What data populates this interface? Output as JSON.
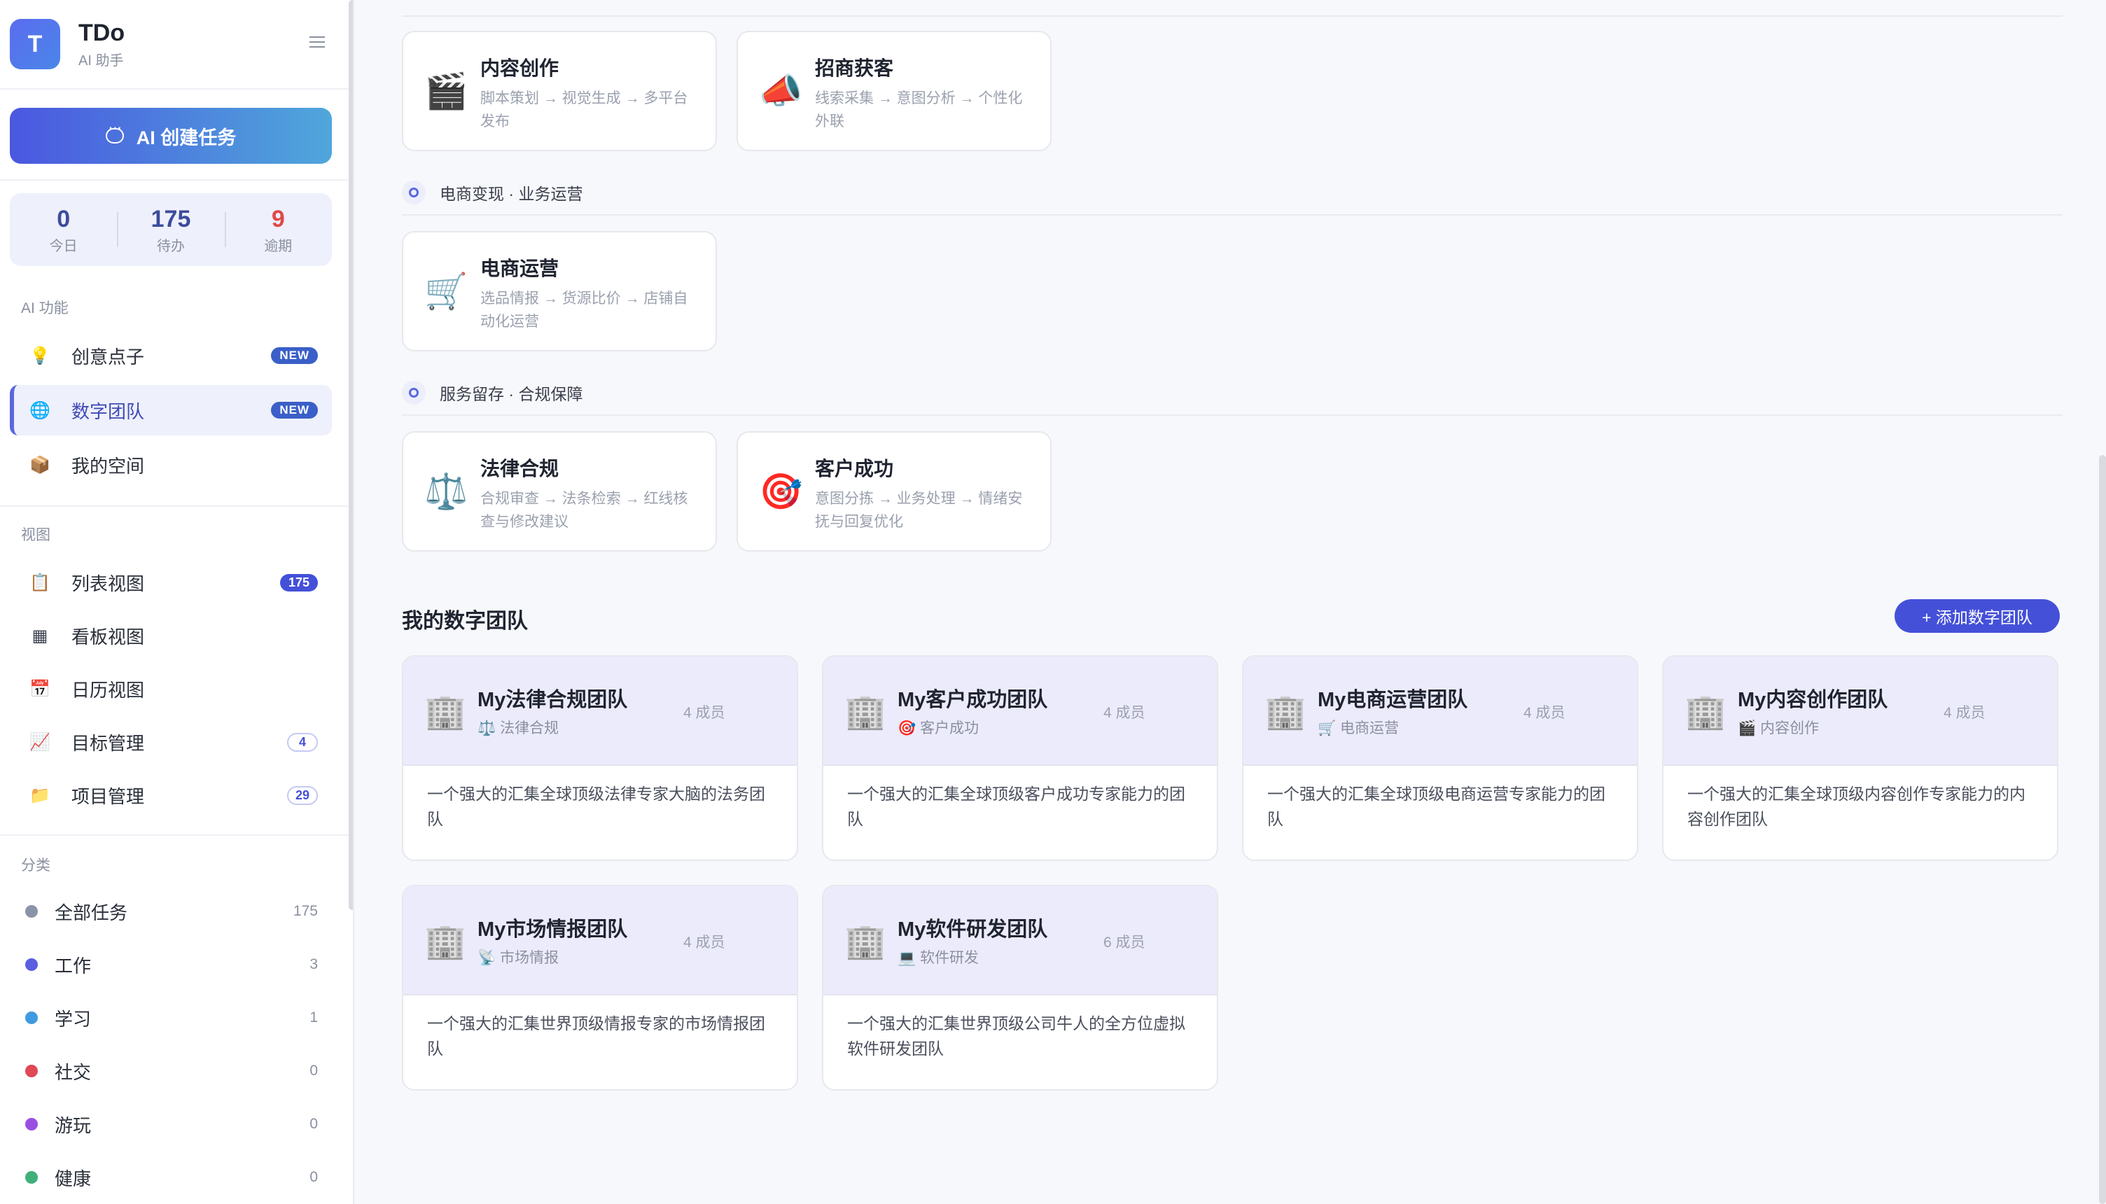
{
  "brand": {
    "name": "TDo",
    "subtitle": "AI 助手",
    "logo_letter": "T"
  },
  "ai_button": "AI 创建任务",
  "stats": [
    {
      "value": "0",
      "label": "今日"
    },
    {
      "value": "175",
      "label": "待办"
    },
    {
      "value": "9",
      "label": "逾期"
    }
  ],
  "sections": {
    "ai": "AI 功能",
    "views": "视图",
    "categories": "分类"
  },
  "ai_items": [
    {
      "label": "创意点子",
      "badge": "NEW",
      "icon": "💡"
    },
    {
      "label": "数字团队",
      "badge": "NEW",
      "icon": "🌐"
    },
    {
      "label": "我的空间",
      "icon": "📦"
    }
  ],
  "view_items": [
    {
      "label": "列表视图",
      "badge": "175",
      "icon": "📋"
    },
    {
      "label": "看板视图",
      "icon": "▦"
    },
    {
      "label": "日历视图",
      "icon": "📅"
    },
    {
      "label": "目标管理",
      "badge": "4",
      "icon": "📈"
    },
    {
      "label": "项目管理",
      "badge": "29",
      "icon": "📁"
    }
  ],
  "categories": [
    {
      "label": "全部任务",
      "count": "175",
      "color": "#8b93a8"
    },
    {
      "label": "工作",
      "count": "3",
      "color": "#5b5fe0"
    },
    {
      "label": "学习",
      "count": "1",
      "color": "#3f9be0"
    },
    {
      "label": "社交",
      "count": "0",
      "color": "#e04857"
    },
    {
      "label": "游玩",
      "count": "0",
      "color": "#9b4fe0"
    },
    {
      "label": "健康",
      "count": "0",
      "color": "#3fb07a"
    }
  ],
  "capability_sections": [
    {
      "title": "电商变现 · 业务运营"
    },
    {
      "title": "服务留存 · 合规保障"
    }
  ],
  "capabilities": [
    {
      "title": "内容创作",
      "desc": "脚本策划 → 视觉生成 → 多平台发布",
      "icon": "🎬"
    },
    {
      "title": "招商获客",
      "desc": "线索采集 → 意图分析 → 个性化外联",
      "icon": "📣"
    },
    {
      "title": "电商运营",
      "desc": "选品情报 → 货源比价 → 店铺自动化运营",
      "icon": "🛒"
    },
    {
      "title": "法律合规",
      "desc": "合规审查 → 法条检索 → 红线核查与修改建议",
      "icon": "⚖️"
    },
    {
      "title": "客户成功",
      "desc": "意图分拣 → 业务处理 → 情绪安抚与回复优化",
      "icon": "🎯"
    }
  ],
  "my_teams_title": "我的数字团队",
  "add_team_button": "+ 添加数字团队",
  "teams": [
    {
      "name": "My法律合规团队",
      "tag": "⚖️ 法律合规",
      "members": "4 成员",
      "desc": "一个强大的汇集全球顶级法律专家大脑的法务团队",
      "icon": "🏢"
    },
    {
      "name": "My客户成功团队",
      "tag": "🎯 客户成功",
      "members": "4 成员",
      "desc": "一个强大的汇集全球顶级客户成功专家能力的团队",
      "icon": "🏢"
    },
    {
      "name": "My电商运营团队",
      "tag": "🛒 电商运营",
      "members": "4 成员",
      "desc": "一个强大的汇集全球顶级电商运营专家能力的团队",
      "icon": "🏢"
    },
    {
      "name": "My内容创作团队",
      "tag": "🎬 内容创作",
      "members": "4 成员",
      "desc": "一个强大的汇集全球顶级内容创作专家能力的内容创作团队",
      "icon": "🏢"
    },
    {
      "name": "My市场情报团队",
      "tag": "📡 市场情报",
      "members": "4 成员",
      "desc": "一个强大的汇集世界顶级情报专家的市场情报团队",
      "icon": "🏢"
    },
    {
      "name": "My软件研发团队",
      "tag": "💻 软件研发",
      "members": "6 成员",
      "desc": "一个强大的汇集世界顶级公司牛人的全方位虚拟软件研发团队",
      "icon": "🏢"
    }
  ]
}
